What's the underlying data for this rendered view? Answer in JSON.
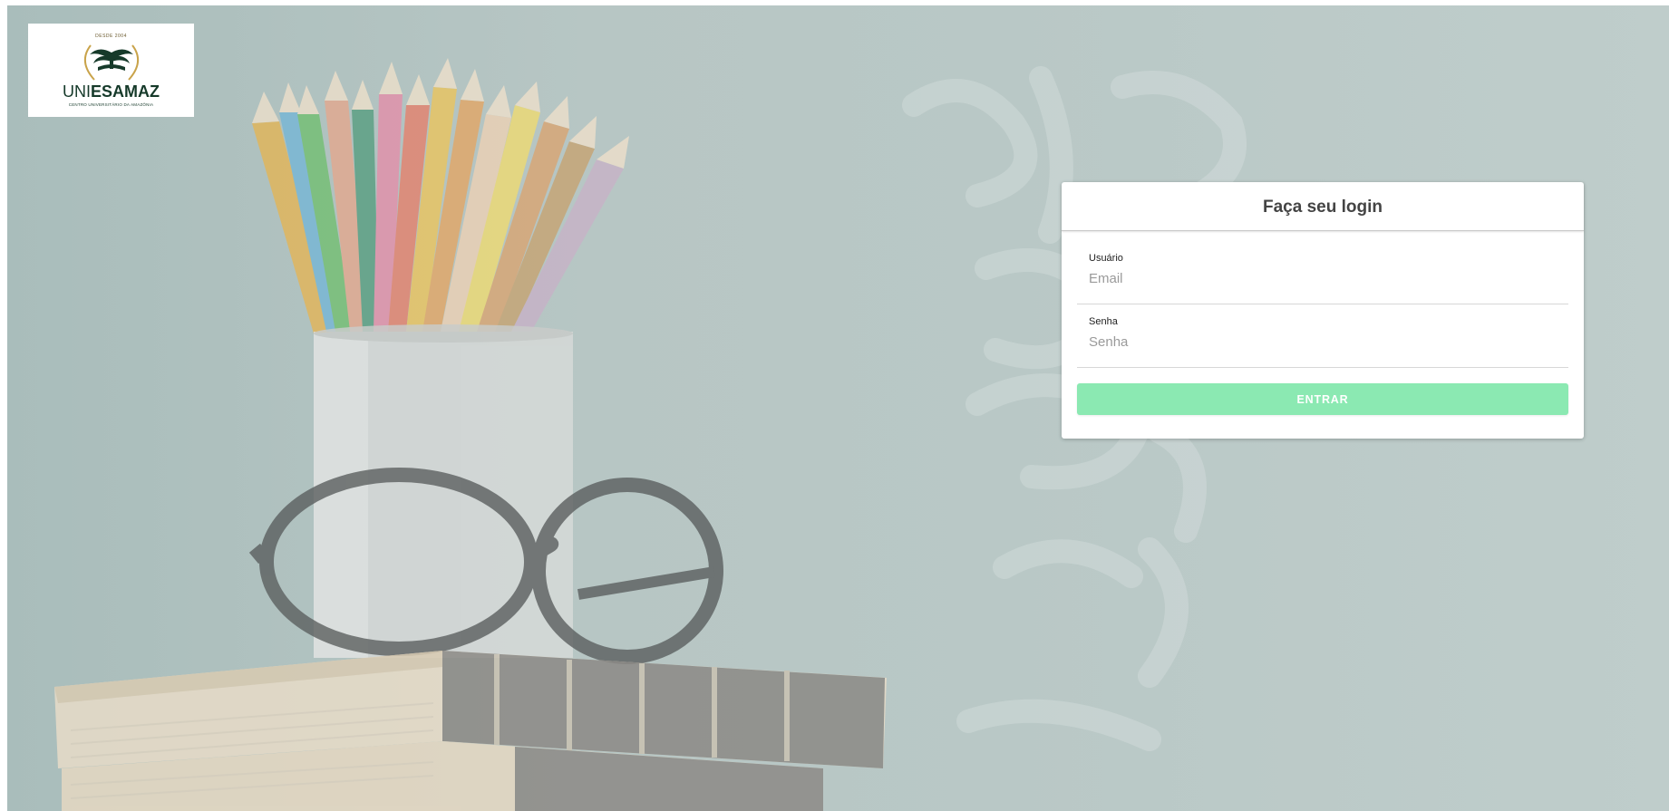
{
  "logo": {
    "since": "DESDE 2004",
    "name_light": "UNI",
    "name_bold": "ESAMAZ",
    "tagline": "CENTRO UNIVERSITÁRIO DA AMAZÔNIA"
  },
  "login": {
    "title": "Faça seu login",
    "username": {
      "label": "Usuário",
      "placeholder": "Email",
      "value": ""
    },
    "password": {
      "label": "Senha",
      "placeholder": "Senha",
      "value": ""
    },
    "submit_label": "ENTRAR"
  },
  "colors": {
    "background": "#b7c6c4",
    "button": "#8be9b2",
    "logo_green": "#163a2a",
    "logo_gold": "#c9a34a"
  }
}
